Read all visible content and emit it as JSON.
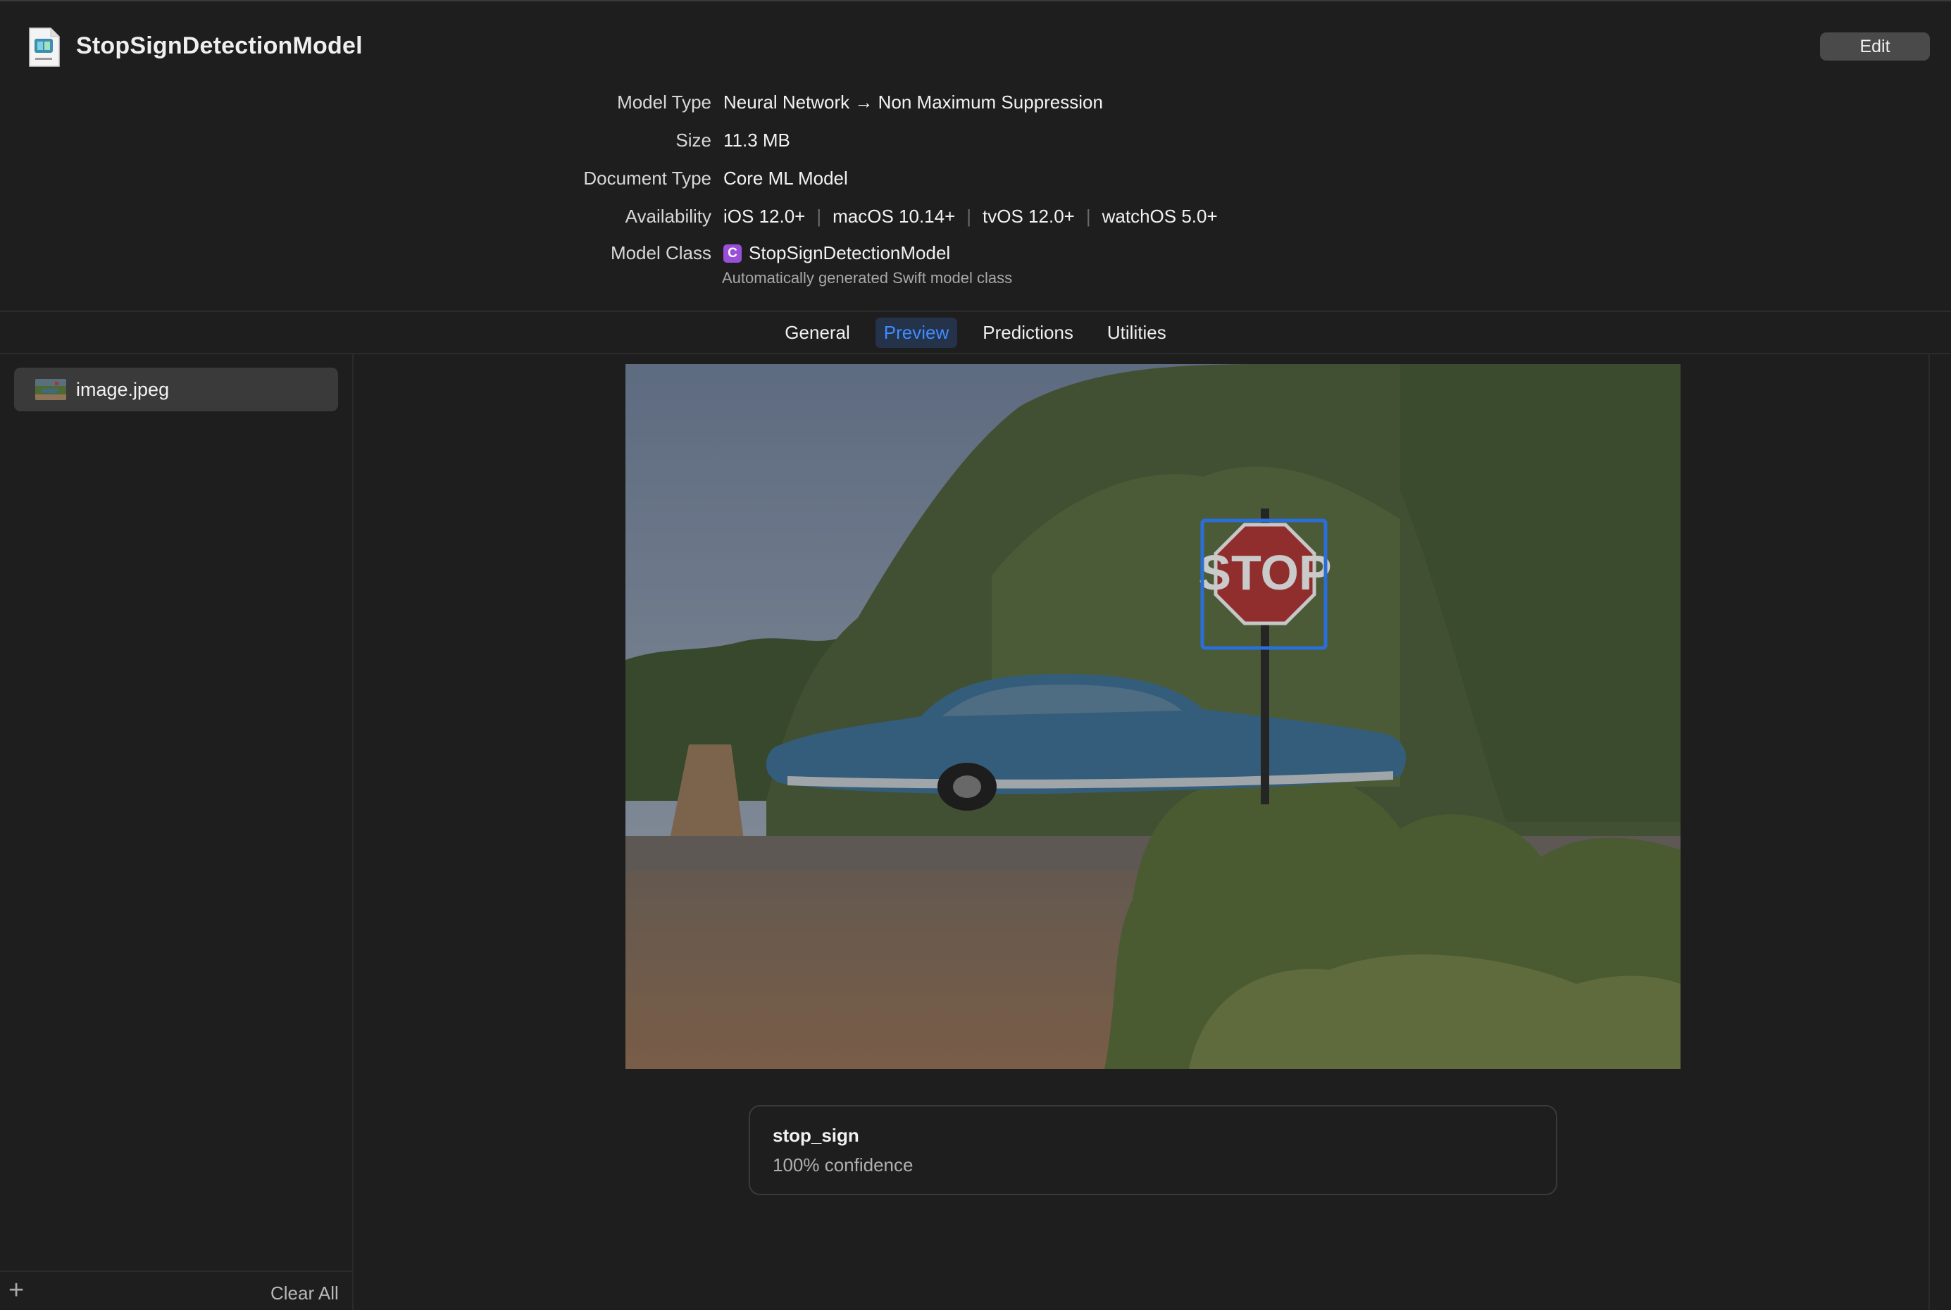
{
  "header": {
    "title": "StopSignDetectionModel",
    "edit_label": "Edit"
  },
  "meta": {
    "model_type_label": "Model Type",
    "model_type_value": "Neural Network → Non Maximum Suppression",
    "size_label": "Size",
    "size_value": "11.3 MB",
    "document_type_label": "Document Type",
    "document_type_value": "Core ML Model",
    "availability_label": "Availability",
    "availability": [
      "iOS 12.0+",
      "macOS 10.14+",
      "tvOS 12.0+",
      "watchOS 5.0+"
    ],
    "separator": "|",
    "model_class_label": "Model Class",
    "model_class_badge": "C",
    "model_class_value": "StopSignDetectionModel",
    "model_class_note": "Automatically generated Swift model class"
  },
  "tabs": [
    {
      "label": "General",
      "active": false
    },
    {
      "label": "Preview",
      "active": true
    },
    {
      "label": "Predictions",
      "active": false
    },
    {
      "label": "Utilities",
      "active": false
    }
  ],
  "sidebar": {
    "items": [
      {
        "label": "image.jpeg",
        "selected": true
      }
    ],
    "add_icon": "plus-icon",
    "add_glyph": "+",
    "clear_all_label": "Clear All"
  },
  "preview": {
    "sign_text": "STOP",
    "detection_color": "#2f7ff5"
  },
  "result": {
    "label": "stop_sign",
    "confidence": "100% confidence"
  },
  "colors": {
    "accent": "#3f8cff",
    "background": "#1e1e1e",
    "class_badge": "#9a4fd8"
  }
}
